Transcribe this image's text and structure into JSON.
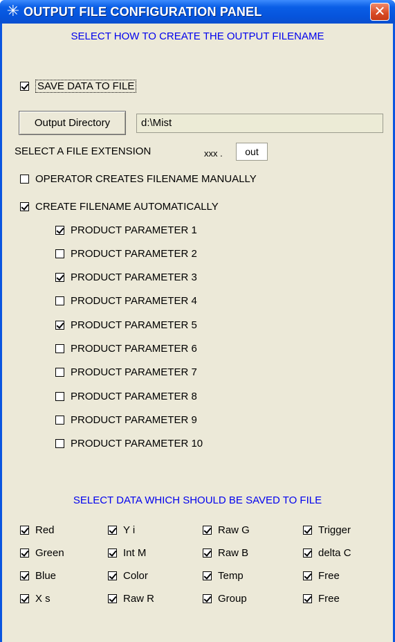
{
  "window": {
    "title": "OUTPUT FILE CONFIGURATION PANEL",
    "title_icon": "sparkle-icon",
    "close_icon": "close-icon",
    "titlebar_color": "#0a5ee6",
    "client_color": "#ece9d8",
    "heading_color": "#0000ee"
  },
  "filename": {
    "heading": "SELECT HOW TO CREATE THE OUTPUT FILENAME",
    "save_data": {
      "label": "SAVE DATA TO FILE",
      "checked": true
    },
    "output_dir_button": "Output Directory",
    "output_dir_value": "d:\\Mist",
    "extension_label": "SELECT A FILE EXTENSION",
    "extension_prefix": "xxx .",
    "extension_value": "out",
    "manual": {
      "label": "OPERATOR CREATES FILENAME MANUALLY",
      "checked": false
    },
    "automatic": {
      "label": "CREATE FILENAME AUTOMATICALLY",
      "checked": true
    },
    "parameters": [
      {
        "label": "PRODUCT PARAMETER 1",
        "checked": true
      },
      {
        "label": "PRODUCT PARAMETER 2",
        "checked": false
      },
      {
        "label": "PRODUCT PARAMETER 3",
        "checked": true
      },
      {
        "label": "PRODUCT PARAMETER 4",
        "checked": false
      },
      {
        "label": "PRODUCT PARAMETER 5",
        "checked": true
      },
      {
        "label": "PRODUCT PARAMETER 6",
        "checked": false
      },
      {
        "label": "PRODUCT PARAMETER 7",
        "checked": false
      },
      {
        "label": "PRODUCT PARAMETER 8",
        "checked": false
      },
      {
        "label": "PRODUCT PARAMETER 9",
        "checked": false
      },
      {
        "label": "PRODUCT PARAMETER 10",
        "checked": false
      }
    ]
  },
  "data_selection": {
    "heading": "SELECT DATA WHICH SHOULD BE SAVED TO FILE",
    "columns": [
      [
        {
          "label": "Red",
          "checked": true
        },
        {
          "label": "Green",
          "checked": true
        },
        {
          "label": "Blue",
          "checked": true
        },
        {
          "label": "X s",
          "checked": true
        }
      ],
      [
        {
          "label": "Y i",
          "checked": true
        },
        {
          "label": "Int M",
          "checked": true
        },
        {
          "label": "Color",
          "checked": true
        },
        {
          "label": "Raw R",
          "checked": true
        }
      ],
      [
        {
          "label": "Raw G",
          "checked": true
        },
        {
          "label": "Raw B",
          "checked": true
        },
        {
          "label": "Temp",
          "checked": true
        },
        {
          "label": "Group",
          "checked": true
        }
      ],
      [
        {
          "label": "Trigger",
          "checked": true
        },
        {
          "label": "delta C",
          "checked": true
        },
        {
          "label": "Free",
          "checked": true
        },
        {
          "label": "Free",
          "checked": true
        }
      ]
    ]
  }
}
